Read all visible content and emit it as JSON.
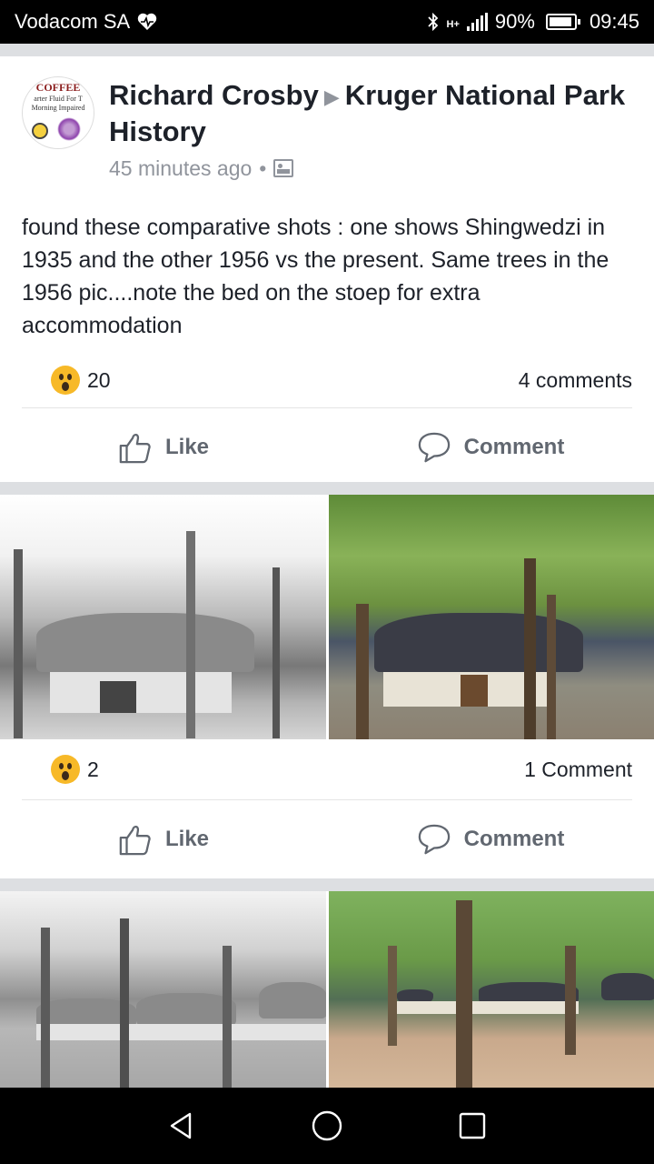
{
  "status_bar": {
    "carrier": "Vodacom SA",
    "network": "H+",
    "battery": "90%",
    "time": "09:45"
  },
  "post": {
    "author": "Richard Crosby",
    "group": "Kruger National Park History",
    "time": "45 minutes ago",
    "avatar_text": {
      "line1": "COFFEE",
      "line2": "arter Fluid For T",
      "line3": "Morning Impaired"
    },
    "text": "found these comparative shots : one shows Shingwedzi in 1935 and the other 1956 vs the present. Same trees in the 1956 pic....note the bed on the stoep for extra accommodation",
    "reaction_count": "20",
    "comments": "4 comments",
    "like_label": "Like",
    "comment_label": "Comment"
  },
  "photo_post_1": {
    "reaction_count": "2",
    "comments": "1 Comment",
    "like_label": "Like",
    "comment_label": "Comment"
  },
  "icons": {
    "reaction": "wow-emoji",
    "like": "thumbs-up-icon",
    "comment": "speech-bubble-icon"
  },
  "colors": {
    "text": "#1d2129",
    "secondary": "#90949c",
    "action": "#616770",
    "separator": "#dddfe2"
  }
}
